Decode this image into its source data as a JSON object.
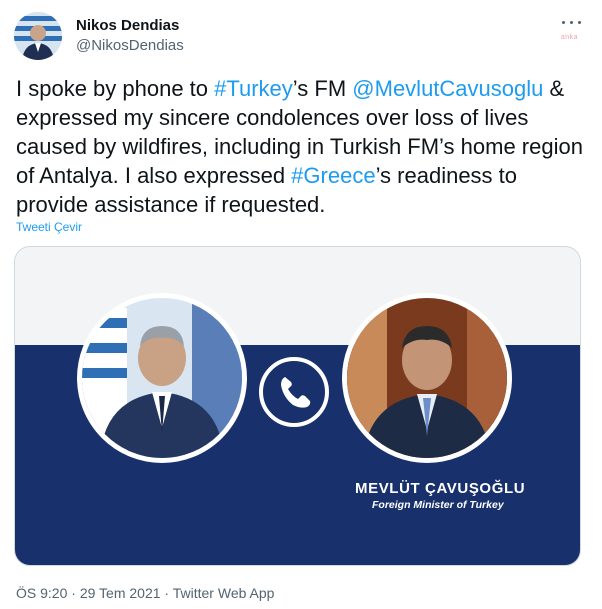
{
  "user": {
    "display_name": "Nikos Dendias",
    "handle": "@NikosDendias"
  },
  "watermark": "anka",
  "tweet": {
    "segments": [
      {
        "text": "I spoke by phone to ",
        "link": false
      },
      {
        "text": "#Turkey",
        "link": true
      },
      {
        "text": "’s FM ",
        "link": false
      },
      {
        "text": "@MevlutCavusoglu",
        "link": true
      },
      {
        "text": " & expressed my sincere condolences over loss of lives caused by wildfires, including in Turkish FM’s home region of Antalya. I also expressed ",
        "link": false
      },
      {
        "text": "#Greece",
        "link": true
      },
      {
        "text": "’s readiness to provide assistance if requested.",
        "link": false
      }
    ],
    "translate_label": "Tweeti Çevir"
  },
  "card": {
    "name_caption": "MEVLÜT ÇAVUŞOĞLU",
    "role_caption": "Foreign Minister of Turkey"
  },
  "meta": {
    "time": "ÖS 9:20",
    "date": "29 Tem 2021",
    "source": "Twitter Web App"
  },
  "colors": {
    "link": "#1d9bf0",
    "card_band": "#18316d",
    "text_secondary": "#536471"
  },
  "icons": {
    "more": "more-horizontal-icon",
    "phone": "phone-icon"
  }
}
